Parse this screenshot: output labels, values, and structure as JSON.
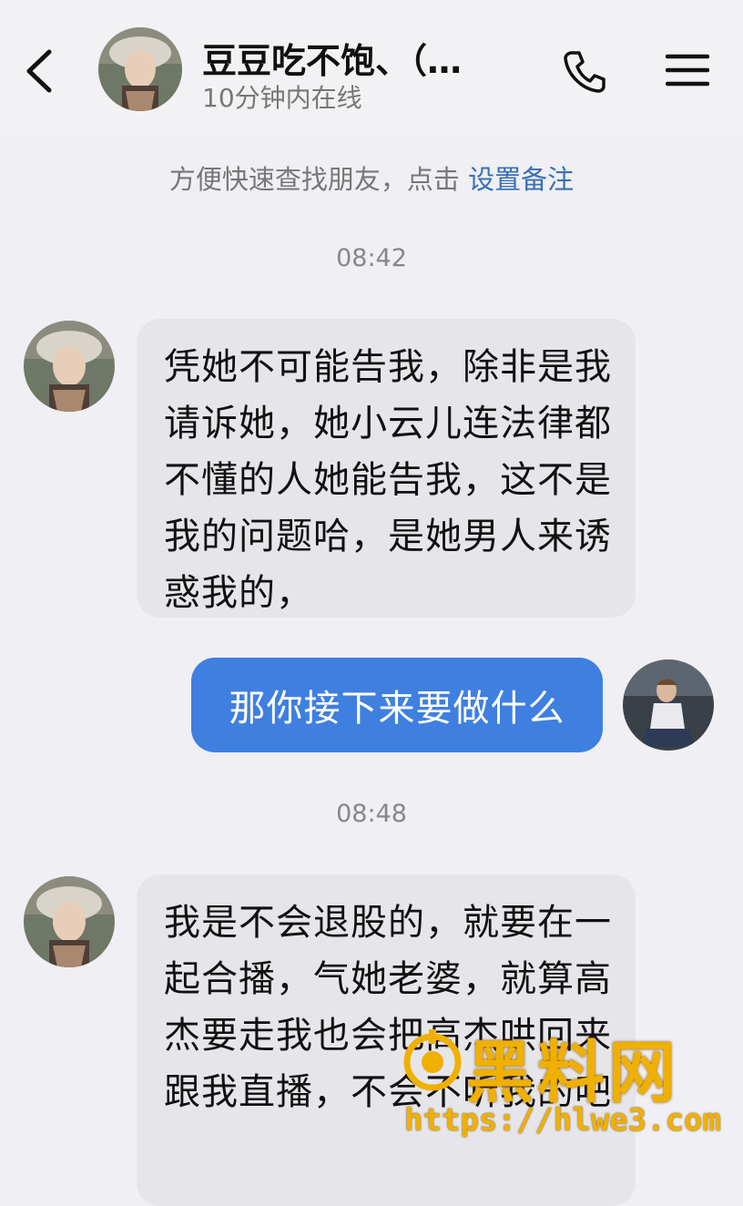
{
  "header": {
    "title": "豆豆吃不饱、（…",
    "status": "10分钟内在线",
    "icons": {
      "back": "chevron-left-icon",
      "call": "phone-icon",
      "menu": "menu-icon"
    }
  },
  "notice": {
    "text": "方便快速查找朋友，点击 ",
    "link": "设置备注"
  },
  "messages": [
    {
      "time": "08:42"
    },
    {
      "from": "contact",
      "text": "凭她不可能告我，除非是我请诉她，她小云儿连法律都不懂的人她能告我，这不是我的问题哈，是她男人来诱惑我的，"
    },
    {
      "from": "me",
      "text": "那你接下来要做什么"
    },
    {
      "time": "08:48"
    },
    {
      "from": "contact",
      "text": "我是不会退股的，就要在一起合播，气她老婆，就算高杰要走我也会把高杰哄回来跟我直播，不会不听我的吧"
    }
  ],
  "watermark": {
    "title": "黑料网",
    "url": "https://hlwe3.com"
  },
  "colors": {
    "accent": "#3f7fe0",
    "link": "#3a6fb4",
    "incoming_bubble": "#e6e6ea",
    "watermark": "#f0b000"
  }
}
